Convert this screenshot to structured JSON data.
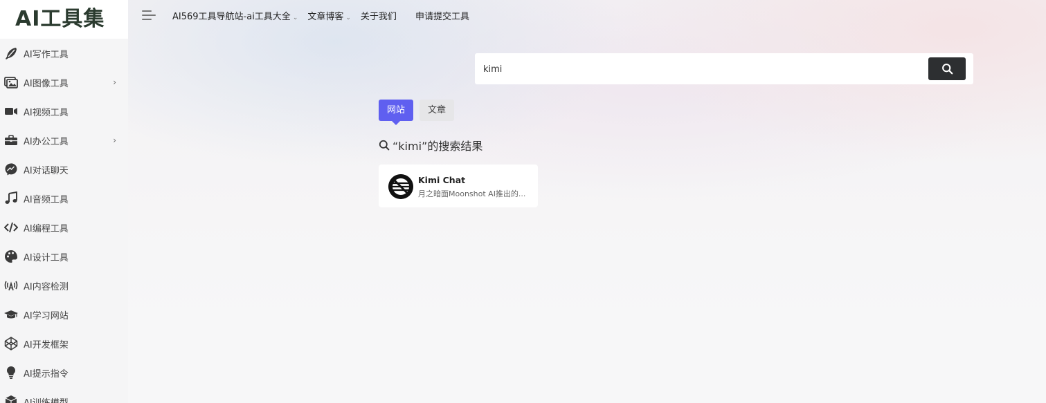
{
  "logo": {
    "text": "AI工具集"
  },
  "sidebar": {
    "items": [
      {
        "label": "AI写作工具",
        "icon": "feather-icon",
        "has_submenu": false
      },
      {
        "label": "AI图像工具",
        "icon": "images-icon",
        "has_submenu": true
      },
      {
        "label": "AI视频工具",
        "icon": "video-camera-icon",
        "has_submenu": false
      },
      {
        "label": "AI办公工具",
        "icon": "briefcase-icon",
        "has_submenu": true
      },
      {
        "label": "AI对话聊天",
        "icon": "messenger-icon",
        "has_submenu": false
      },
      {
        "label": "AI音频工具",
        "icon": "music-note-icon",
        "has_submenu": false
      },
      {
        "label": "AI编程工具",
        "icon": "code-icon",
        "has_submenu": false
      },
      {
        "label": "AI设计工具",
        "icon": "palette-icon",
        "has_submenu": false
      },
      {
        "label": "AI内容检测",
        "icon": "broadcast-icon",
        "has_submenu": false
      },
      {
        "label": "AI学习网站",
        "icon": "graduation-cap-icon",
        "has_submenu": false
      },
      {
        "label": "AI开发框架",
        "icon": "codepen-icon",
        "has_submenu": false
      },
      {
        "label": "AI提示指令",
        "icon": "lightbulb-icon",
        "has_submenu": false
      },
      {
        "label": "AI训练模型",
        "icon": "cube-icon",
        "has_submenu": false
      }
    ]
  },
  "topnav": {
    "links": [
      {
        "label": "AI569工具导航站-ai工具大全",
        "has_dropdown": true
      },
      {
        "label": "文章博客",
        "has_dropdown": true
      },
      {
        "label": "关于我们",
        "has_dropdown": false
      },
      {
        "label": "申请提交工具",
        "has_dropdown": false
      }
    ]
  },
  "search": {
    "value": "kimi"
  },
  "tabs": {
    "site": "网站",
    "article": "文章"
  },
  "results": {
    "heading": "“kimi”的搜索结果",
    "cards": [
      {
        "title": "Kimi Chat",
        "desc": "月之暗面Moonshot AI推出的..."
      }
    ]
  },
  "colors": {
    "accent": "#5f5ff0",
    "search_button": "#2d2f31",
    "logo_swoosh": "#79b84c"
  }
}
